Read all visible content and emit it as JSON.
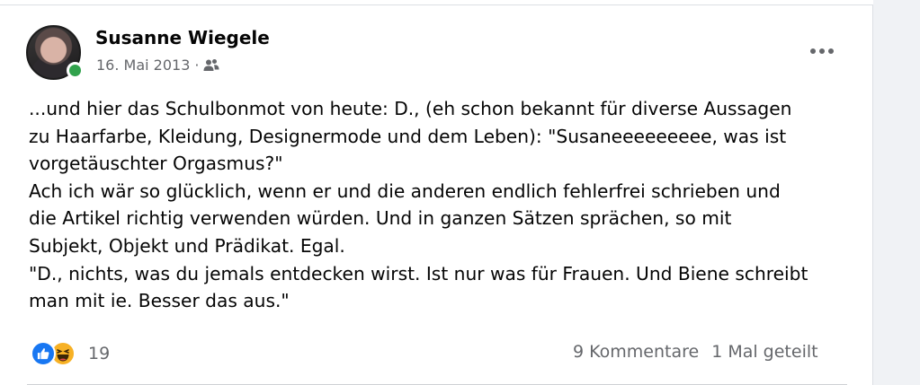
{
  "post": {
    "author": "Susanne Wiegele",
    "date": "16. Mai 2013",
    "separator": "·",
    "audience_icon": "friends-icon",
    "paragraphs": [
      "...und hier das Schulbonmot von heute: D., (eh schon bekannt für diverse Aussagen",
      "zu Haarfarbe, Kleidung, Designermode und dem Leben): \"Susaneeeeeeeee, was ist",
      "vorgetäuschter Orgasmus?\"",
      "Ach ich wär so glücklich, wenn er und die anderen endlich fehlerfrei schrieben und",
      "die Artikel richtig verwenden würden. Und in ganzen Sätzen sprächen, so mit",
      "Subjekt, Objekt und Prädikat. Egal.",
      "\"D., nichts, was du jemals entdecken wirst. Ist nur was für Frauen. Und Biene schreibt",
      "man mit ie. Besser das aus.\""
    ]
  },
  "footer": {
    "reaction_count": "19",
    "comments": "9 Kommentare",
    "shares": "1 Mal geteilt"
  },
  "colors": {
    "like_blue": "#1877f2",
    "haha_yellow": "#f7b125",
    "online_green": "#31a24c",
    "secondary_text": "#65676b"
  }
}
